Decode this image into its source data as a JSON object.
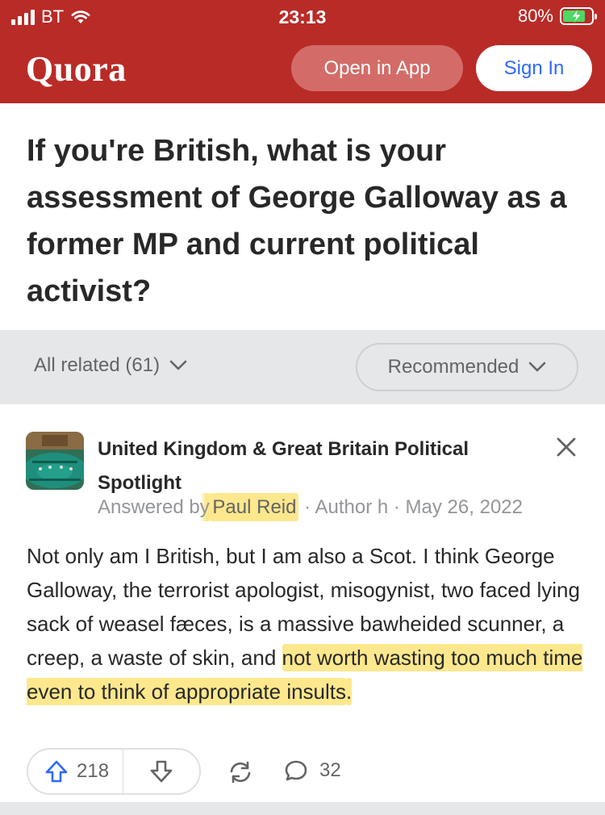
{
  "status_bar": {
    "carrier": "BT",
    "time": "23:13",
    "battery": "80%",
    "battery_level": 0.8
  },
  "header": {
    "logo": "Quora",
    "open_in_app": "Open in App",
    "sign_in": "Sign In"
  },
  "question": {
    "title": "If you're British, what is your assessment of George Galloway as a former MP and current political activist?"
  },
  "filters": {
    "all_related": "All related (61)",
    "sort": "Recommended"
  },
  "answer": {
    "space_name": "United Kingdom & Great Britain Political Spotlight",
    "answered_by_prefix": "Answered b",
    "answered_by_y": "y",
    "author": "Paul Reid",
    "author_role": "· Author h",
    "date": "· May 26, 2022",
    "body_part1": "Not only am I British, but I am also a Scot. I think George Galloway, the terrorist apologist, misogynist, two faced lying sack of weasel fæces, is a massive bawheided scunner, a creep, a waste of skin, and ",
    "body_highlight": "not worth wasting too much time even to think of appropriate insults",
    "body_part2": ".",
    "highlight_color": "#fde88d"
  },
  "actions": {
    "upvotes": "218",
    "comments": "32"
  },
  "colors": {
    "brand": "#b92b27",
    "sign_in_text": "#2e69ff"
  },
  "icons": {
    "wifi": "wifi-icon",
    "signal": "signal-icon",
    "battery": "battery-charging-icon",
    "close": "close-icon",
    "upvote": "upvote-arrow-icon",
    "downvote": "downvote-arrow-icon",
    "share": "share-icon",
    "comment": "comment-icon"
  }
}
